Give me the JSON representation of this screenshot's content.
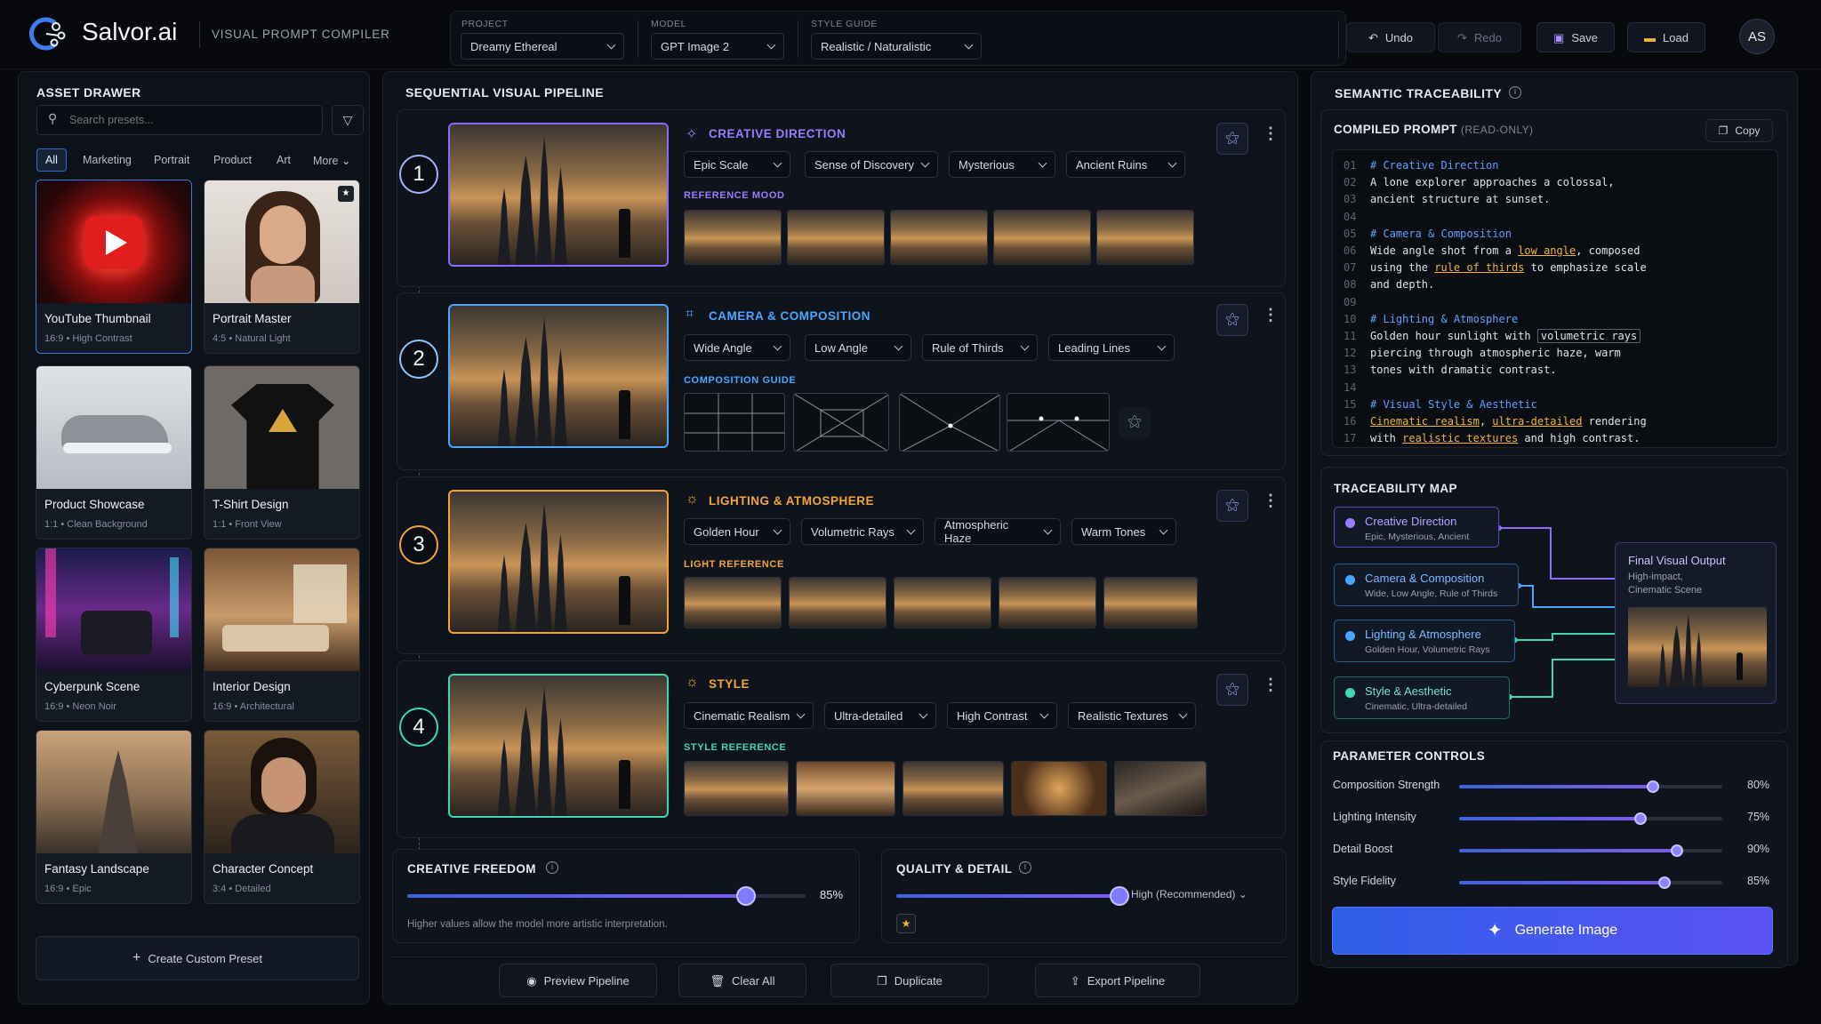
{
  "header": {
    "app_name": "Salvor.ai",
    "app_subtitle": "VISUAL PROMPT COMPILER",
    "project_label": "PROJECT",
    "project_value": "Dreamy Ethereal",
    "model_label": "MODEL",
    "model_value": "GPT Image 2",
    "style_label": "STYLE GUIDE",
    "style_value": "Realistic / Naturalistic",
    "undo": "Undo",
    "redo": "Redo",
    "save": "Save",
    "load": "Load",
    "avatar": "AS"
  },
  "drawer": {
    "title": "ASSET DRAWER",
    "search_placeholder": "Search presets...",
    "tabs": [
      "All",
      "Marketing",
      "Portrait",
      "Product",
      "Art",
      "More"
    ],
    "assets": [
      {
        "title": "YouTube Thumbnail",
        "meta": "16:9  •  High Contrast"
      },
      {
        "title": "Portrait Master",
        "meta": "4:5  •  Natural Light"
      },
      {
        "title": "Product Showcase",
        "meta": "1:1  •  Clean Background"
      },
      {
        "title": "T-Shirt Design",
        "meta": "1:1  •  Front View"
      },
      {
        "title": "Cyberpunk Scene",
        "meta": "16:9  •  Neon Noir"
      },
      {
        "title": "Interior Design",
        "meta": "16:9  •  Architectural"
      },
      {
        "title": "Fantasy Landscape",
        "meta": "16:9  •  Epic"
      },
      {
        "title": "Character Concept",
        "meta": "3:4  •  Detailed"
      }
    ],
    "create_button": "Create Custom Preset"
  },
  "pipeline": {
    "title": "SEQUENTIAL VISUAL PIPELINE",
    "stages": [
      {
        "num": "1",
        "title": "CREATIVE DIRECTION",
        "ref_label": "REFERENCE MOOD",
        "color": "#9a7cff",
        "options": [
          "Epic Scale",
          "Sense of Discovery",
          "Mysterious",
          "Ancient Ruins"
        ]
      },
      {
        "num": "2",
        "title": "CAMERA & COMPOSITION",
        "ref_label": "COMPOSITION GUIDE",
        "color": "#4aa6ff",
        "options": [
          "Wide Angle",
          "Low Angle",
          "Rule of Thirds",
          "Leading Lines"
        ]
      },
      {
        "num": "3",
        "title": "LIGHTING & ATMOSPHERE",
        "ref_label": "LIGHT REFERENCE",
        "color": "#f2a43a",
        "options": [
          "Golden Hour",
          "Volumetric Rays",
          "Atmospheric Haze",
          "Warm Tones"
        ]
      },
      {
        "num": "4",
        "title": "STYLE",
        "ref_label": "STYLE REFERENCE",
        "color": "#3fd6b4",
        "options": [
          "Cinematic Realism",
          "Ultra-detailed",
          "High Contrast",
          "Realistic Textures"
        ]
      }
    ],
    "creative_freedom": {
      "label": "CREATIVE FREEDOM",
      "value": "85%",
      "level": 0.85,
      "hint": "Higher values allow the model more artistic interpretation."
    },
    "quality": {
      "label": "QUALITY & DETAIL",
      "value": "High (Recommended)",
      "level": 0.98
    },
    "actions": [
      "Preview Pipeline",
      "Clear All",
      "Duplicate",
      "Export Pipeline"
    ]
  },
  "trace": {
    "title": "SEMANTIC TRACEABILITY",
    "compiled_label": "COMPILED PROMPT",
    "compiled_note": "(READ-ONLY)",
    "copy": "Copy",
    "code": [
      "# Creative Direction",
      "A lone explorer approaches a colossal,",
      "ancient structure at sunset.",
      "",
      "# Camera & Composition",
      "Wide angle shot from a low angle, composed",
      "using the rule of thirds to emphasize scale",
      "and depth.",
      "",
      "# Lighting & Atmosphere",
      "Golden hour sunlight with volumetric rays",
      "piercing through atmospheric haze, warm",
      "tones with dramatic contrast.",
      "",
      "# Visual Style & Aesthetic",
      "Cinematic realism, ultra-detailed rendering",
      "with realistic textures and high contrast."
    ],
    "line_numbers": [
      "01",
      "02",
      "03",
      "04",
      "05",
      "06",
      "07",
      "08",
      "09",
      "10",
      "11",
      "12",
      "13",
      "14",
      "15",
      "16",
      "17"
    ],
    "map_title": "TRACEABILITY MAP",
    "map_items": [
      {
        "title": "Creative Direction",
        "desc": "Epic, Mysterious, Ancient"
      },
      {
        "title": "Camera & Composition",
        "desc": "Wide, Low Angle, Rule of Thirds"
      },
      {
        "title": "Lighting & Atmosphere",
        "desc": "Golden Hour, Volumetric Rays"
      },
      {
        "title": "Style & Aesthetic",
        "desc": "Cinematic, Ultra-detailed"
      }
    ],
    "output_title": "Final Visual Output",
    "output_desc1": "High-impact,",
    "output_desc2": "Cinematic Scene",
    "params_title": "PARAMETER CONTROLS",
    "params": [
      {
        "label": "Composition Strength",
        "value": "80%",
        "level": 0.8
      },
      {
        "label": "Lighting Intensity",
        "value": "75%",
        "level": 0.75
      },
      {
        "label": "Detail Boost",
        "value": "90%",
        "level": 0.9
      },
      {
        "label": "Style Fidelity",
        "value": "85%",
        "level": 0.85
      }
    ],
    "generate": "Generate Image"
  }
}
